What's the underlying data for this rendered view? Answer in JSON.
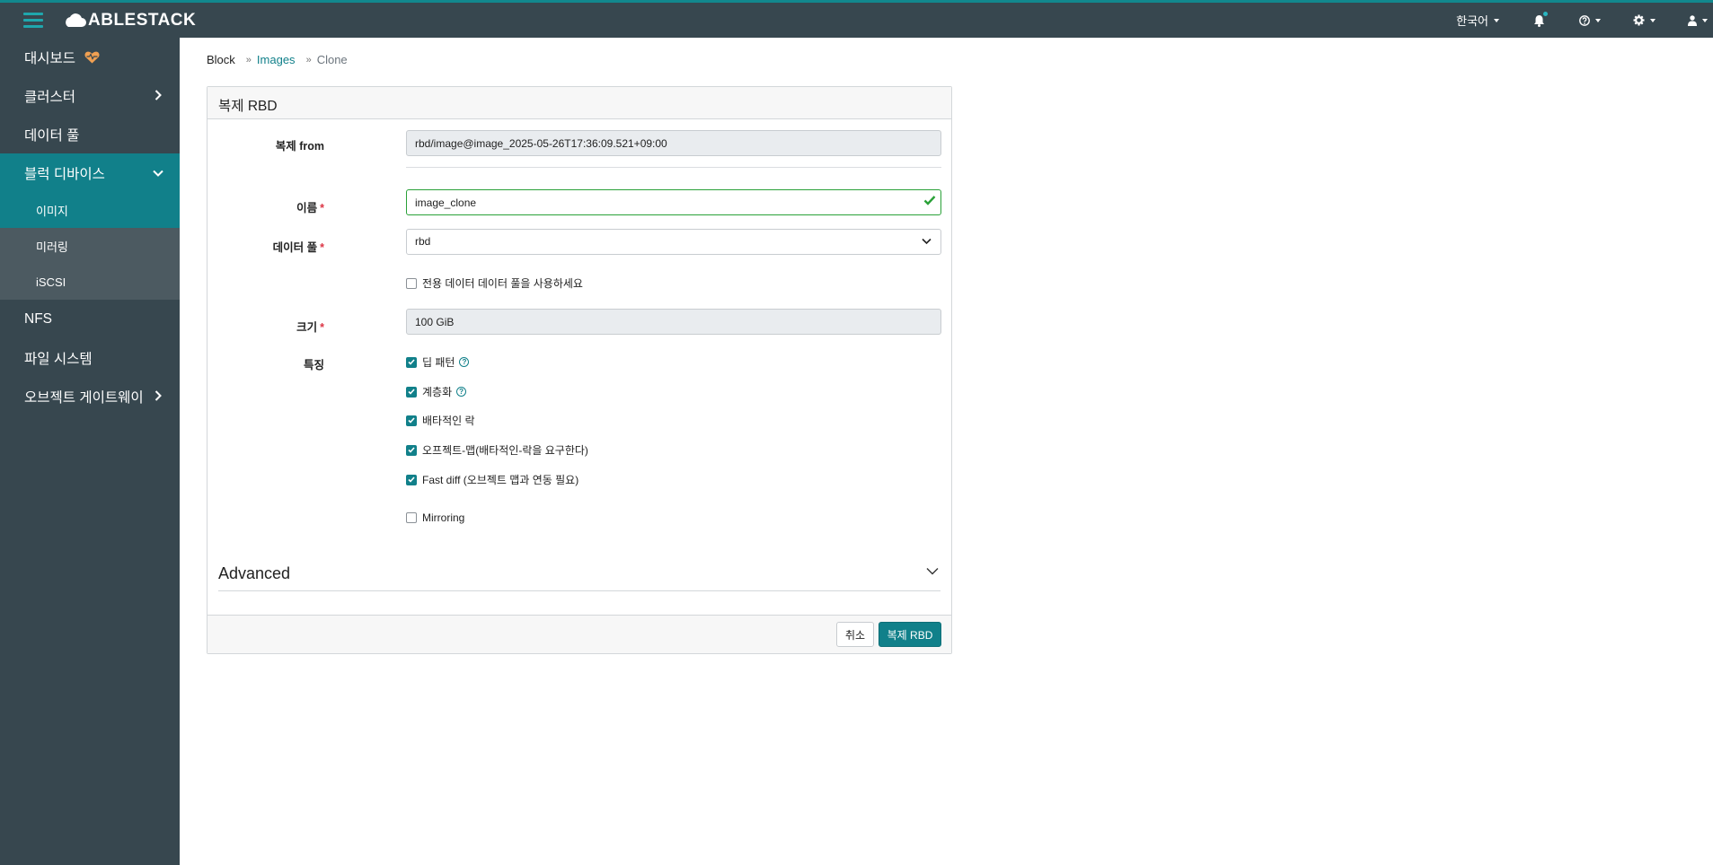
{
  "app": {
    "brand": "ABLESTACK"
  },
  "navbar": {
    "language": "한국어",
    "icons": [
      "menu-icon",
      "bell-icon",
      "help-icon",
      "gear-icon",
      "user-icon"
    ]
  },
  "sidebar": {
    "items": [
      {
        "label": "대시보드"
      },
      {
        "label": "클러스터"
      },
      {
        "label": "데이터 풀"
      },
      {
        "label": "블럭 디바이스"
      },
      {
        "label": "NFS"
      },
      {
        "label": "파일 시스템"
      },
      {
        "label": "오브젝트 게이트웨이"
      }
    ],
    "sub_items": [
      {
        "label": "이미지"
      },
      {
        "label": "미러링"
      },
      {
        "label": "iSCSI"
      }
    ]
  },
  "breadcrumb": {
    "root": "Block",
    "link": "Images",
    "current": "Clone"
  },
  "form": {
    "title": "복제 RBD",
    "clone_from": {
      "label": "복제 from",
      "value": "rbd/image@image_2025-05-26T17:36:09.521+09:00"
    },
    "name": {
      "label": "이름",
      "value": "image_clone"
    },
    "pool": {
      "label": "데이터 풀",
      "value": "rbd"
    },
    "dedicated_pool": {
      "label": "전용 데이터 데이터 풀을 사용하세요",
      "checked": false
    },
    "size": {
      "label": "크기",
      "value": "100 GiB"
    },
    "features": {
      "label": "특징",
      "items": [
        {
          "label": "딥 패턴",
          "checked": true,
          "help": true
        },
        {
          "label": "계층화",
          "checked": true,
          "help": true
        },
        {
          "label": "배타적인 락",
          "checked": true
        },
        {
          "label": "오프젝트-맵(배타적인-락을 요구한다)",
          "checked": true
        },
        {
          "label": "Fast diff (오브젝트 맵과 연동 필요)",
          "checked": true
        }
      ]
    },
    "mirroring": {
      "label": "Mirroring",
      "checked": false
    },
    "advanced": "Advanced",
    "required_mark": "*",
    "cancel_label": "취소",
    "submit_label": "복제 RBD"
  },
  "colors": {
    "navbar": "#37474f",
    "accent": "#11808a",
    "valid": "#2aa138",
    "required": "#dc3545"
  }
}
